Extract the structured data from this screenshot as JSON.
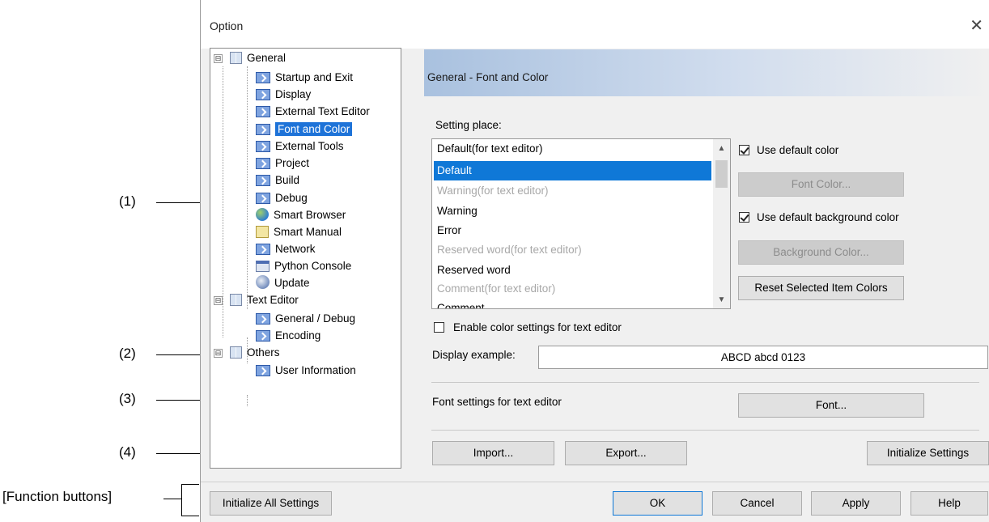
{
  "annotations": {
    "label_1": "(1)",
    "label_2": "(2)",
    "label_3": "(3)",
    "label_4": "(4)",
    "function_buttons": "[Function buttons]"
  },
  "window": {
    "title": "Option",
    "close_icon": "close-icon"
  },
  "tree": {
    "general": "General",
    "startup_exit": "Startup and Exit",
    "display": "Display",
    "external_text_editor": "External Text Editor",
    "font_and_color": "Font and Color",
    "external_tools": "External Tools",
    "project": "Project",
    "build": "Build",
    "debug": "Debug",
    "smart_browser": "Smart Browser",
    "smart_manual": "Smart Manual",
    "network": "Network",
    "python_console": "Python Console",
    "update": "Update",
    "text_editor": "Text Editor",
    "general_debug": "General / Debug",
    "encoding": "Encoding",
    "others": "Others",
    "user_information": "User Information",
    "expander_symbol": "⊟"
  },
  "panel": {
    "header": "General - Font and Color",
    "setting_place_label": "Setting place:",
    "setting_place_items": [
      {
        "text": "Default(for text editor)",
        "state": "disabled"
      },
      {
        "text": "Default",
        "state": "selected"
      },
      {
        "text": "Warning(for text editor)",
        "state": "disabled"
      },
      {
        "text": "Warning",
        "state": "normal"
      },
      {
        "text": "Error",
        "state": "normal"
      },
      {
        "text": "Reserved word(for text editor)",
        "state": "disabled"
      },
      {
        "text": "Reserved word",
        "state": "normal"
      },
      {
        "text": "Comment(for text editor)",
        "state": "disabled"
      },
      {
        "text": "Comment",
        "state": "normal"
      }
    ],
    "use_default_color": "Use default color",
    "font_color_button": "Font Color...",
    "use_default_background_color": "Use default background color",
    "background_color_button": "Background Color...",
    "reset_selected_button": "Reset Selected Item Colors",
    "enable_color_settings": "Enable color settings for text editor",
    "display_example_label": "Display example:",
    "display_example_value": "ABCD abcd 0123",
    "font_settings_label": "Font settings for text editor",
    "font_button": "Font...",
    "import_button": "Import...",
    "export_button": "Export...",
    "initialize_settings_button": "Initialize Settings"
  },
  "footer": {
    "initialize_all_button": "Initialize All Settings",
    "ok_button": "OK",
    "cancel_button": "Cancel",
    "apply_button": "Apply",
    "help_button": "Help"
  }
}
